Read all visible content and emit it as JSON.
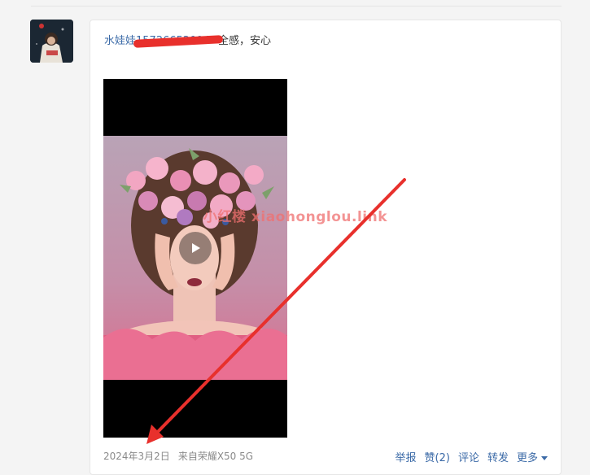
{
  "post": {
    "username": "水娃娃15726652094",
    "text": "全感，安心",
    "watermark": "小红楼 xiaohonglou.link"
  },
  "meta": {
    "date": "2024年3月2日",
    "source": "来自荣耀X50 5G"
  },
  "actions": {
    "report": "举报",
    "like": "赞(2)",
    "comment": "评论",
    "share": "转发",
    "more": "更多"
  },
  "colors": {
    "link": "#3b6aa7",
    "annotation_arrow": "#e8302c",
    "redaction": "#e8302c"
  },
  "icons": {
    "play": "play-icon",
    "more": "chevron-down-icon"
  }
}
